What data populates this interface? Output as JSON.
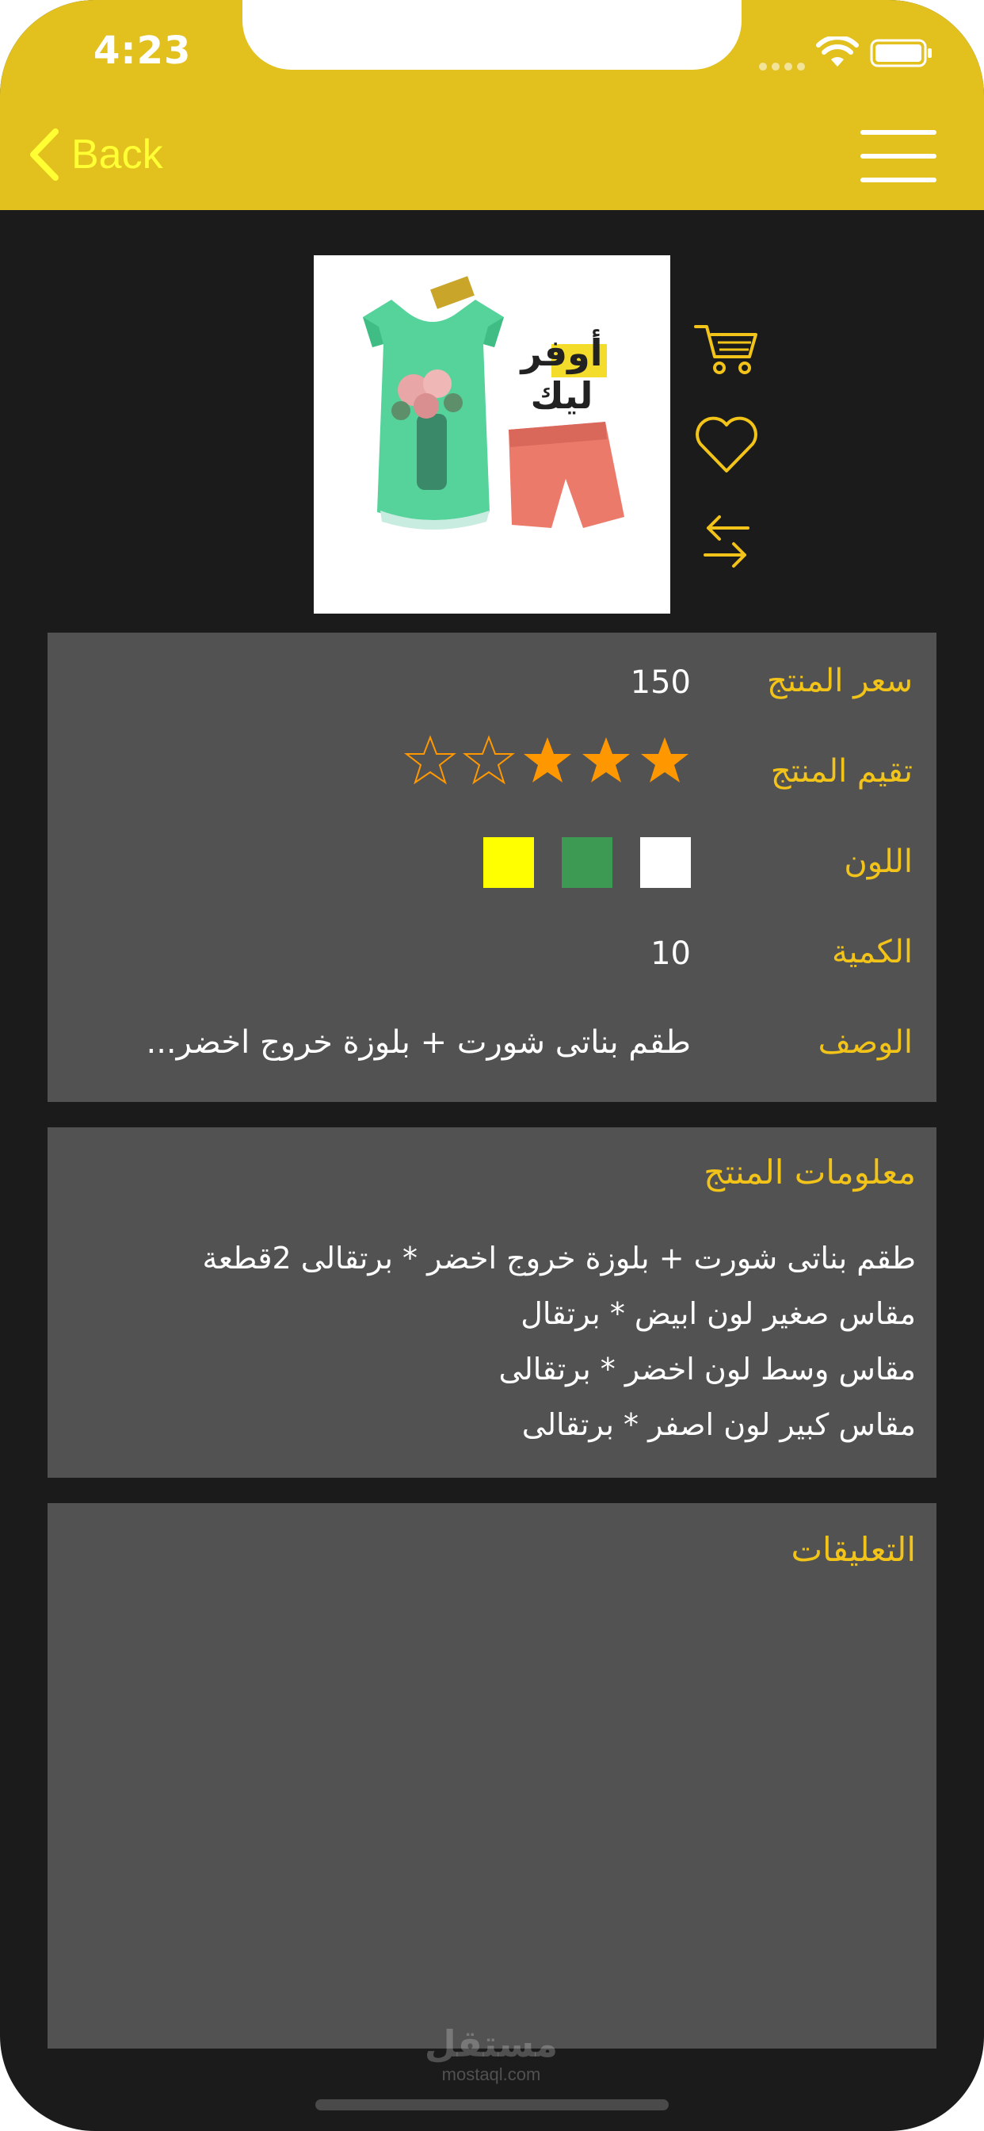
{
  "status": {
    "time": "4:23"
  },
  "nav": {
    "back_label": "Back"
  },
  "product": {
    "image_logo_text": "أوفر ليك",
    "rows": {
      "price_label": "سعر المنتج",
      "price_value": "150",
      "rating_label": "تقيم المنتج",
      "rating_value": 3,
      "rating_max": 5,
      "color_label": "اللون",
      "colors": [
        "#ffffff",
        "#3d9a52",
        "#ffff00"
      ],
      "quantity_label": "الكمية",
      "quantity_value": "10",
      "description_label": "الوصف",
      "description_value": "طقم بناتى شورت + بلوزة خروج اخضر..."
    }
  },
  "info": {
    "title": "معلومات المنتج",
    "lines": [
      "طقم بناتى شورت + بلوزة خروج اخضر * برتقالى 2قطعة",
      "مقاس صغير لون ابيض * برتقال",
      "مقاس وسط لون اخضر * برتقالى",
      "مقاس كبير لون اصفر * برتقالى"
    ]
  },
  "comments": {
    "title": "التعليقات"
  },
  "watermark": {
    "arabic": "مستقل",
    "latin": "mostaql.com"
  },
  "colors": {
    "header": "#e2c11f",
    "accent_text": "#f2c318",
    "panel": "#525252",
    "background": "#1b1b1b",
    "star_filled": "#ff9800"
  }
}
